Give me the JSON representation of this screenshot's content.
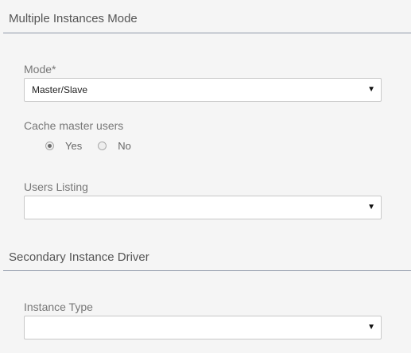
{
  "sections": {
    "multiple_instances": {
      "title": "Multiple Instances Mode"
    },
    "secondary_driver": {
      "title": "Secondary Instance Driver"
    }
  },
  "fields": {
    "mode": {
      "label": "Mode*",
      "value": "Master/Slave",
      "arrow": "▼"
    },
    "cache_master_users": {
      "label": "Cache master users",
      "options": [
        "Yes",
        "No"
      ],
      "selected": "Yes"
    },
    "users_listing": {
      "label": "Users Listing",
      "value": "",
      "arrow": "▼"
    },
    "instance_type": {
      "label": "Instance Type",
      "value": "",
      "arrow": "▼"
    }
  }
}
